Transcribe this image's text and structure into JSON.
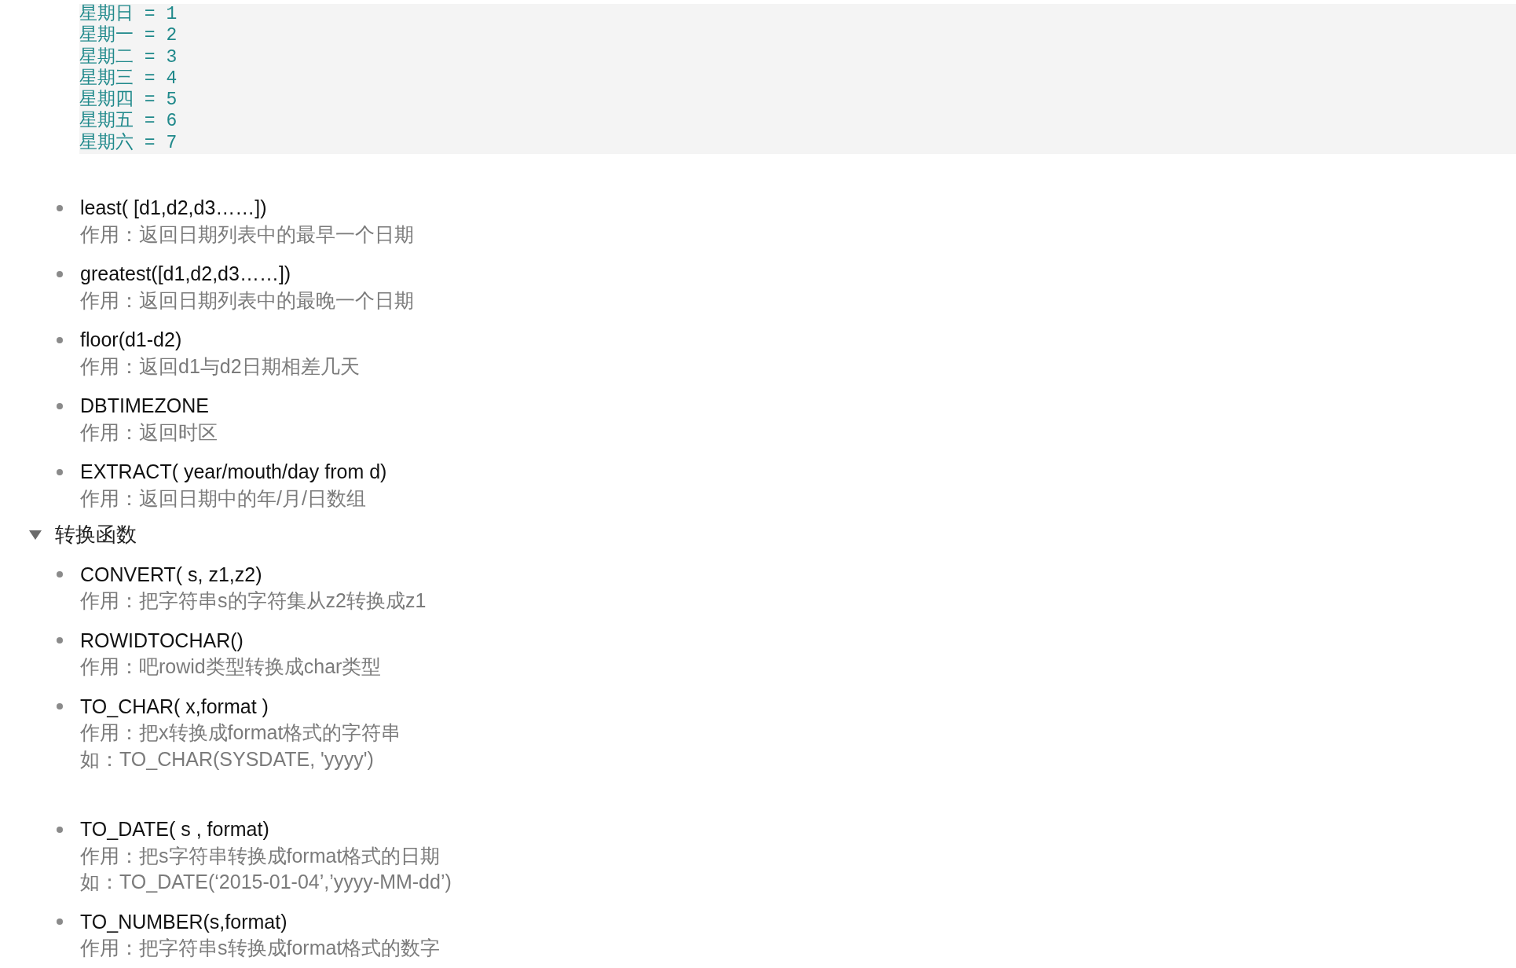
{
  "code_block": {
    "lines": [
      "星期日 = 1",
      "星期一 = 2",
      "星期二 = 3",
      "星期三 = 4",
      "星期四 = 5",
      "星期五 = 6",
      "星期六 = 7"
    ]
  },
  "items": [
    {
      "title": "least( [d1,d2,d3……])",
      "notes": [
        "作用：返回日期列表中的最早一个日期"
      ]
    },
    {
      "title": "greatest([d1,d2,d3……])",
      "notes": [
        "作用：返回日期列表中的最晚一个日期"
      ]
    },
    {
      "title": "floor(d1-d2)",
      "notes": [
        "作用：返回d1与d2日期相差几天"
      ]
    },
    {
      "title": "DBTIMEZONE",
      "notes": [
        "作用：返回时区"
      ]
    },
    {
      "title": "EXTRACT( year/mouth/day from d)",
      "notes": [
        "作用：返回日期中的年/月/日数组"
      ]
    }
  ],
  "sections": [
    {
      "title": "转换函数",
      "expanded": true,
      "items": [
        {
          "title": "CONVERT( s, z1,z2)",
          "notes": [
            "作用：把字符串s的字符集从z2转换成z1"
          ]
        },
        {
          "title": "ROWIDTOCHAR()",
          "notes": [
            "作用：吧rowid类型转换成char类型"
          ]
        },
        {
          "title": "TO_CHAR( x,format )",
          "notes": [
            "作用：把x转换成format格式的字符串",
            "如：TO_CHAR(SYSDATE, 'yyyy')"
          ]
        },
        {
          "title": "TO_DATE( s , format)",
          "notes": [
            "作用：把s字符串转换成format格式的日期",
            "如：TO_DATE(‘2015-01-04’,’yyyy-MM-dd’)"
          ]
        },
        {
          "title": "TO_NUMBER(s,format)",
          "notes": [
            "作用：把字符串s转换成format格式的数字"
          ]
        }
      ]
    }
  ]
}
